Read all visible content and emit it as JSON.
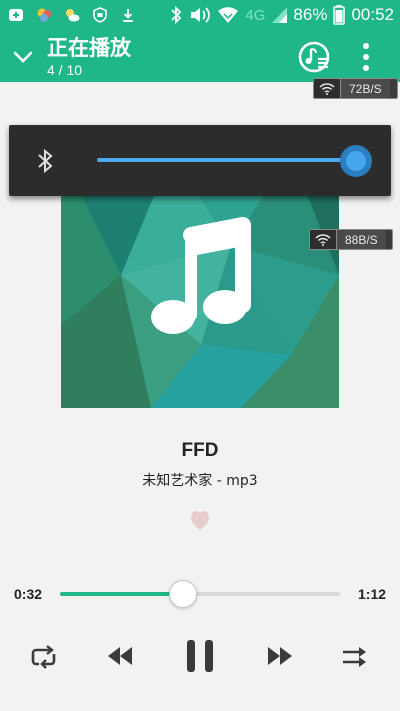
{
  "status_bar": {
    "battery_percent": "86%",
    "time": "00:52",
    "network_type": "4G",
    "icons": [
      "notification-icon",
      "app-icon",
      "weather-icon",
      "security-icon",
      "download-icon",
      "bluetooth-icon",
      "volume-icon",
      "wifi-icon",
      "signal-icon",
      "battery-icon"
    ]
  },
  "app_bar": {
    "title": "正在播放",
    "track_position": "4 / 10",
    "icons": [
      "chevron-down-icon",
      "music-queue-icon",
      "more-vert-icon"
    ]
  },
  "network_speed": {
    "badge_top": "72B/S",
    "badge_mid": "88B/S"
  },
  "volume_panel": {
    "source": "bluetooth-icon",
    "level": 1.0
  },
  "track": {
    "title": "FFD",
    "artist_format": "未知艺术家 - mp3",
    "favorite": false
  },
  "playback": {
    "current_time": "0:32",
    "total_time": "1:12",
    "progress": 0.44
  },
  "controls": [
    "repeat-icon",
    "previous-icon",
    "pause-icon",
    "next-icon",
    "shuffle-icon"
  ],
  "colors": {
    "accent": "#1fb787",
    "volume_accent": "#46a7ef",
    "heart": "#e9cccc"
  }
}
